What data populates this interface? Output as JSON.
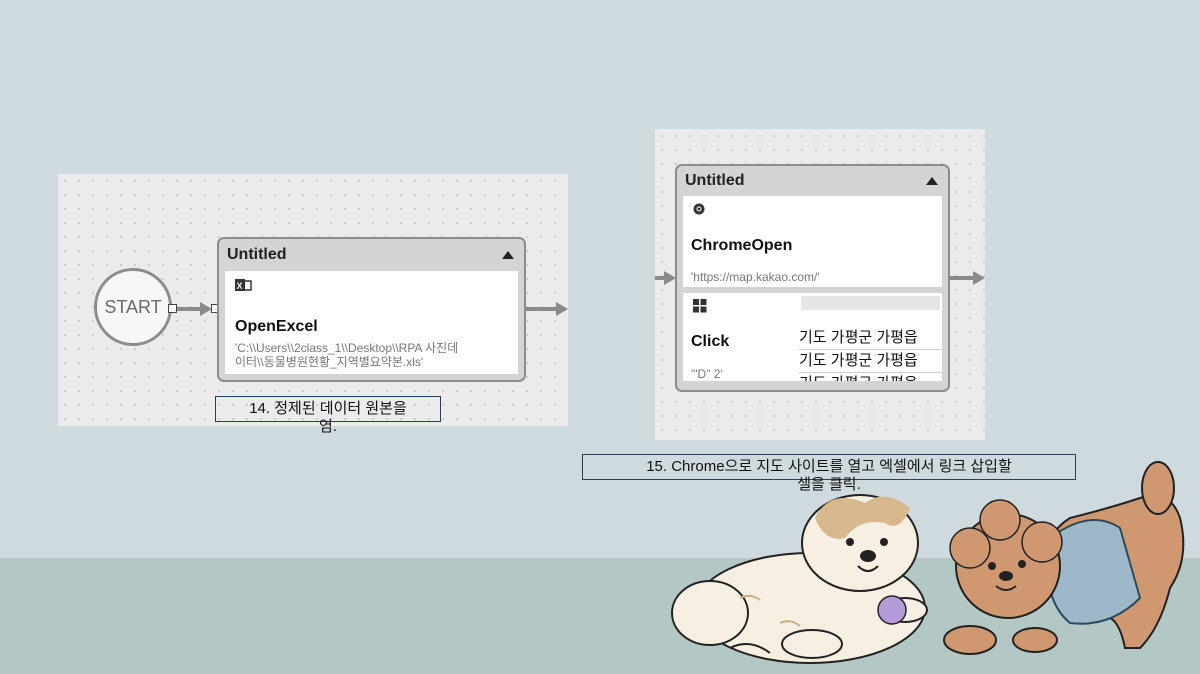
{
  "slide": {
    "caption14_line1": "14. 정제된 데이터 원본을",
    "caption14_line2": "염.",
    "caption15_line1": "15. Chrome으로 지도 사이트를 열고 엑셀에서 링크 삽입할",
    "caption15_line2": "셀을 클릭."
  },
  "flow_left": {
    "start_label": "START",
    "group_title": "Untitled",
    "action": {
      "name": "OpenExcel",
      "arg_line1": "'C:\\\\Users\\\\2class_1\\\\Desktop\\\\RPA 사진데",
      "arg_line2": "이터\\\\동물병원현황_지역별요약본.xls'"
    }
  },
  "flow_right": {
    "group_title": "Untitled",
    "action1": {
      "name": "ChromeOpen",
      "arg": "'https://map.kakao.com/'"
    },
    "action2": {
      "name": "Click",
      "arg": "'\"D\" 2'"
    },
    "preview_rows": [
      "기도 가평군 가평읍",
      "기도 가평군 가평읍",
      "기도 가평군 가평읍"
    ]
  },
  "icons": {
    "excel": "excel-icon",
    "chrome": "chrome-icon",
    "windows": "windows-icon"
  }
}
